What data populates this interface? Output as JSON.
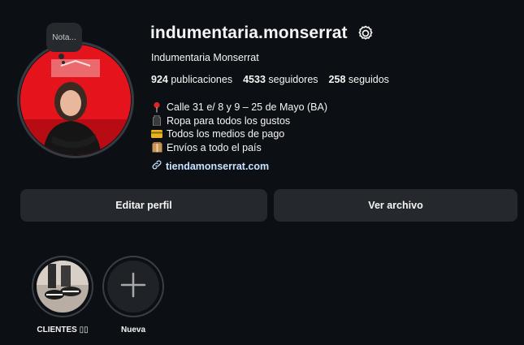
{
  "profile": {
    "note_label": "Nota...",
    "username": "indumentaria.monserrat",
    "full_name": "Indumentaria Monserrat",
    "stats": {
      "posts_count": "924",
      "posts_label": "publicaciones",
      "followers_count": "4533",
      "followers_label": "seguidores",
      "following_count": "258",
      "following_label": "seguidos"
    },
    "bio": [
      {
        "icon": "pin-icon",
        "text": "Calle 31 e/ 8 y 9 – 25 de Mayo (BA)"
      },
      {
        "icon": "clothing-icon",
        "text": "Ropa para todos los gustos"
      },
      {
        "icon": "credit-card-icon",
        "text": "Todos los medios de pago"
      },
      {
        "icon": "package-icon",
        "text": "Envíos a todo el país"
      }
    ],
    "link": "tiendamonserrat.com"
  },
  "actions": {
    "edit_profile": "Editar perfil",
    "view_archive": "Ver archivo"
  },
  "highlights": [
    {
      "label": "CLIENTES ▯▯"
    },
    {
      "label": "Nueva"
    }
  ],
  "colors": {
    "background": "#0c1014",
    "button_bg": "#25292e",
    "link": "#c7e2ff",
    "avatar_red": "#e7121b"
  }
}
